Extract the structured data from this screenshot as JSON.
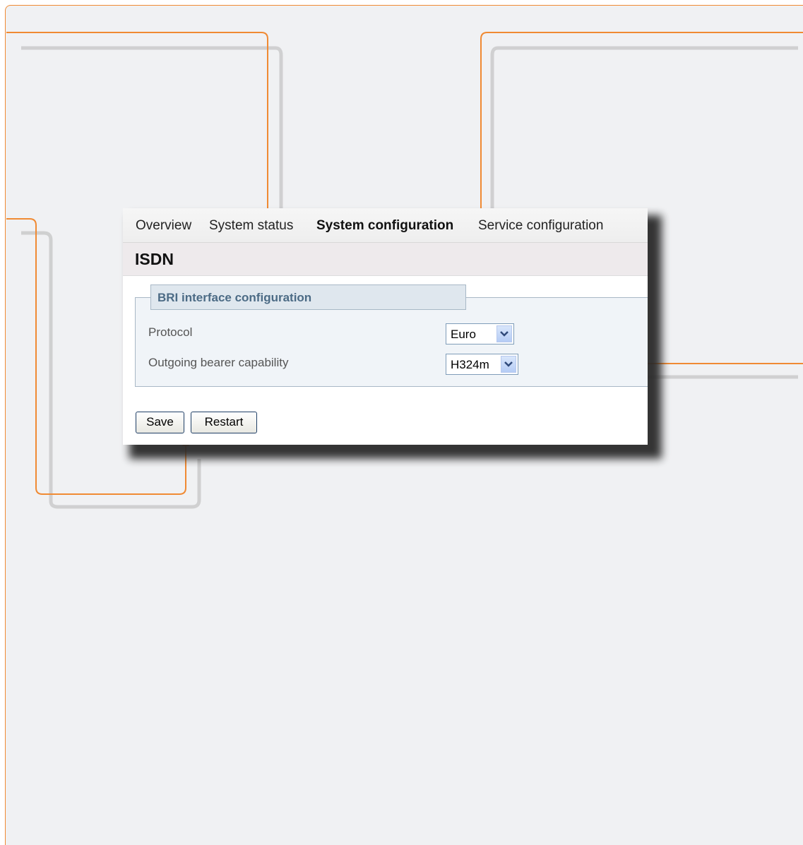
{
  "topnav": {
    "items": [
      {
        "label": "Overview"
      },
      {
        "label": "System status"
      },
      {
        "label": "System configuration",
        "active": true
      },
      {
        "label": "Service configuration"
      }
    ]
  },
  "page": {
    "title": "ISDN"
  },
  "bri_section": {
    "legend": "BRI interface configuration",
    "fields": [
      {
        "label": "Protocol",
        "value": "Euro"
      },
      {
        "label": "Outgoing bearer capability",
        "value": "H324m"
      }
    ]
  },
  "buttons": {
    "save": "Save",
    "restart": "Restart"
  },
  "colors": {
    "callout": "#f08a33",
    "legend_text": "#4c6b85",
    "fieldset_border": "#a8b8c6",
    "canvas_bg": "#f0f1f3"
  }
}
